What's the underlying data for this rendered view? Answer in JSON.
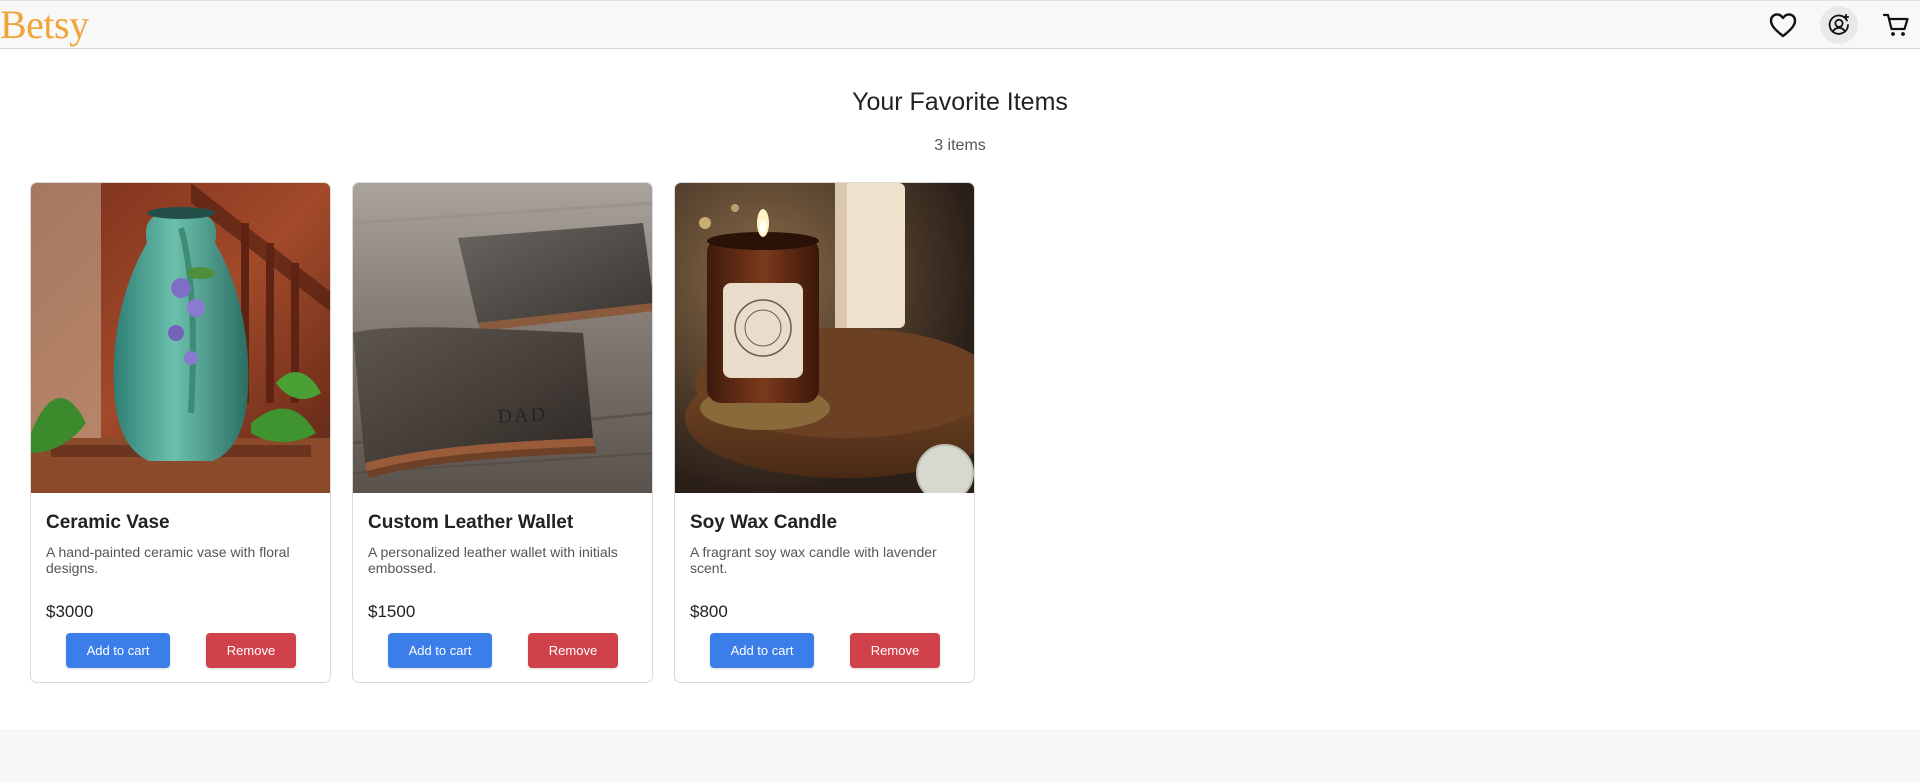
{
  "header": {
    "logo": "Betsy",
    "icons": [
      "heart-icon",
      "user-icon",
      "cart-icon"
    ]
  },
  "main": {
    "title": "Your Favorite Items",
    "count": "3 items",
    "items": [
      {
        "name": "Ceramic Vase",
        "description": "A hand-painted ceramic vase with floral designs.",
        "price": "$3000",
        "add_label": "Add to cart",
        "remove_label": "Remove"
      },
      {
        "name": "Custom Leather Wallet",
        "description": "A personalized leather wallet with initials embossed.",
        "price": "$1500",
        "add_label": "Add to cart",
        "remove_label": "Remove",
        "image_text": "DAD"
      },
      {
        "name": "Soy Wax Candle",
        "description": "A fragrant soy wax candle with lavender scent.",
        "price": "$800",
        "add_label": "Add to cart",
        "remove_label": "Remove"
      }
    ]
  },
  "colors": {
    "logo": "#F1A43A",
    "add_button": "#3B7EEA",
    "remove_button": "#D0414A",
    "header_bg": "#F8F8F8",
    "footer_bg": "#F7F7F7"
  }
}
